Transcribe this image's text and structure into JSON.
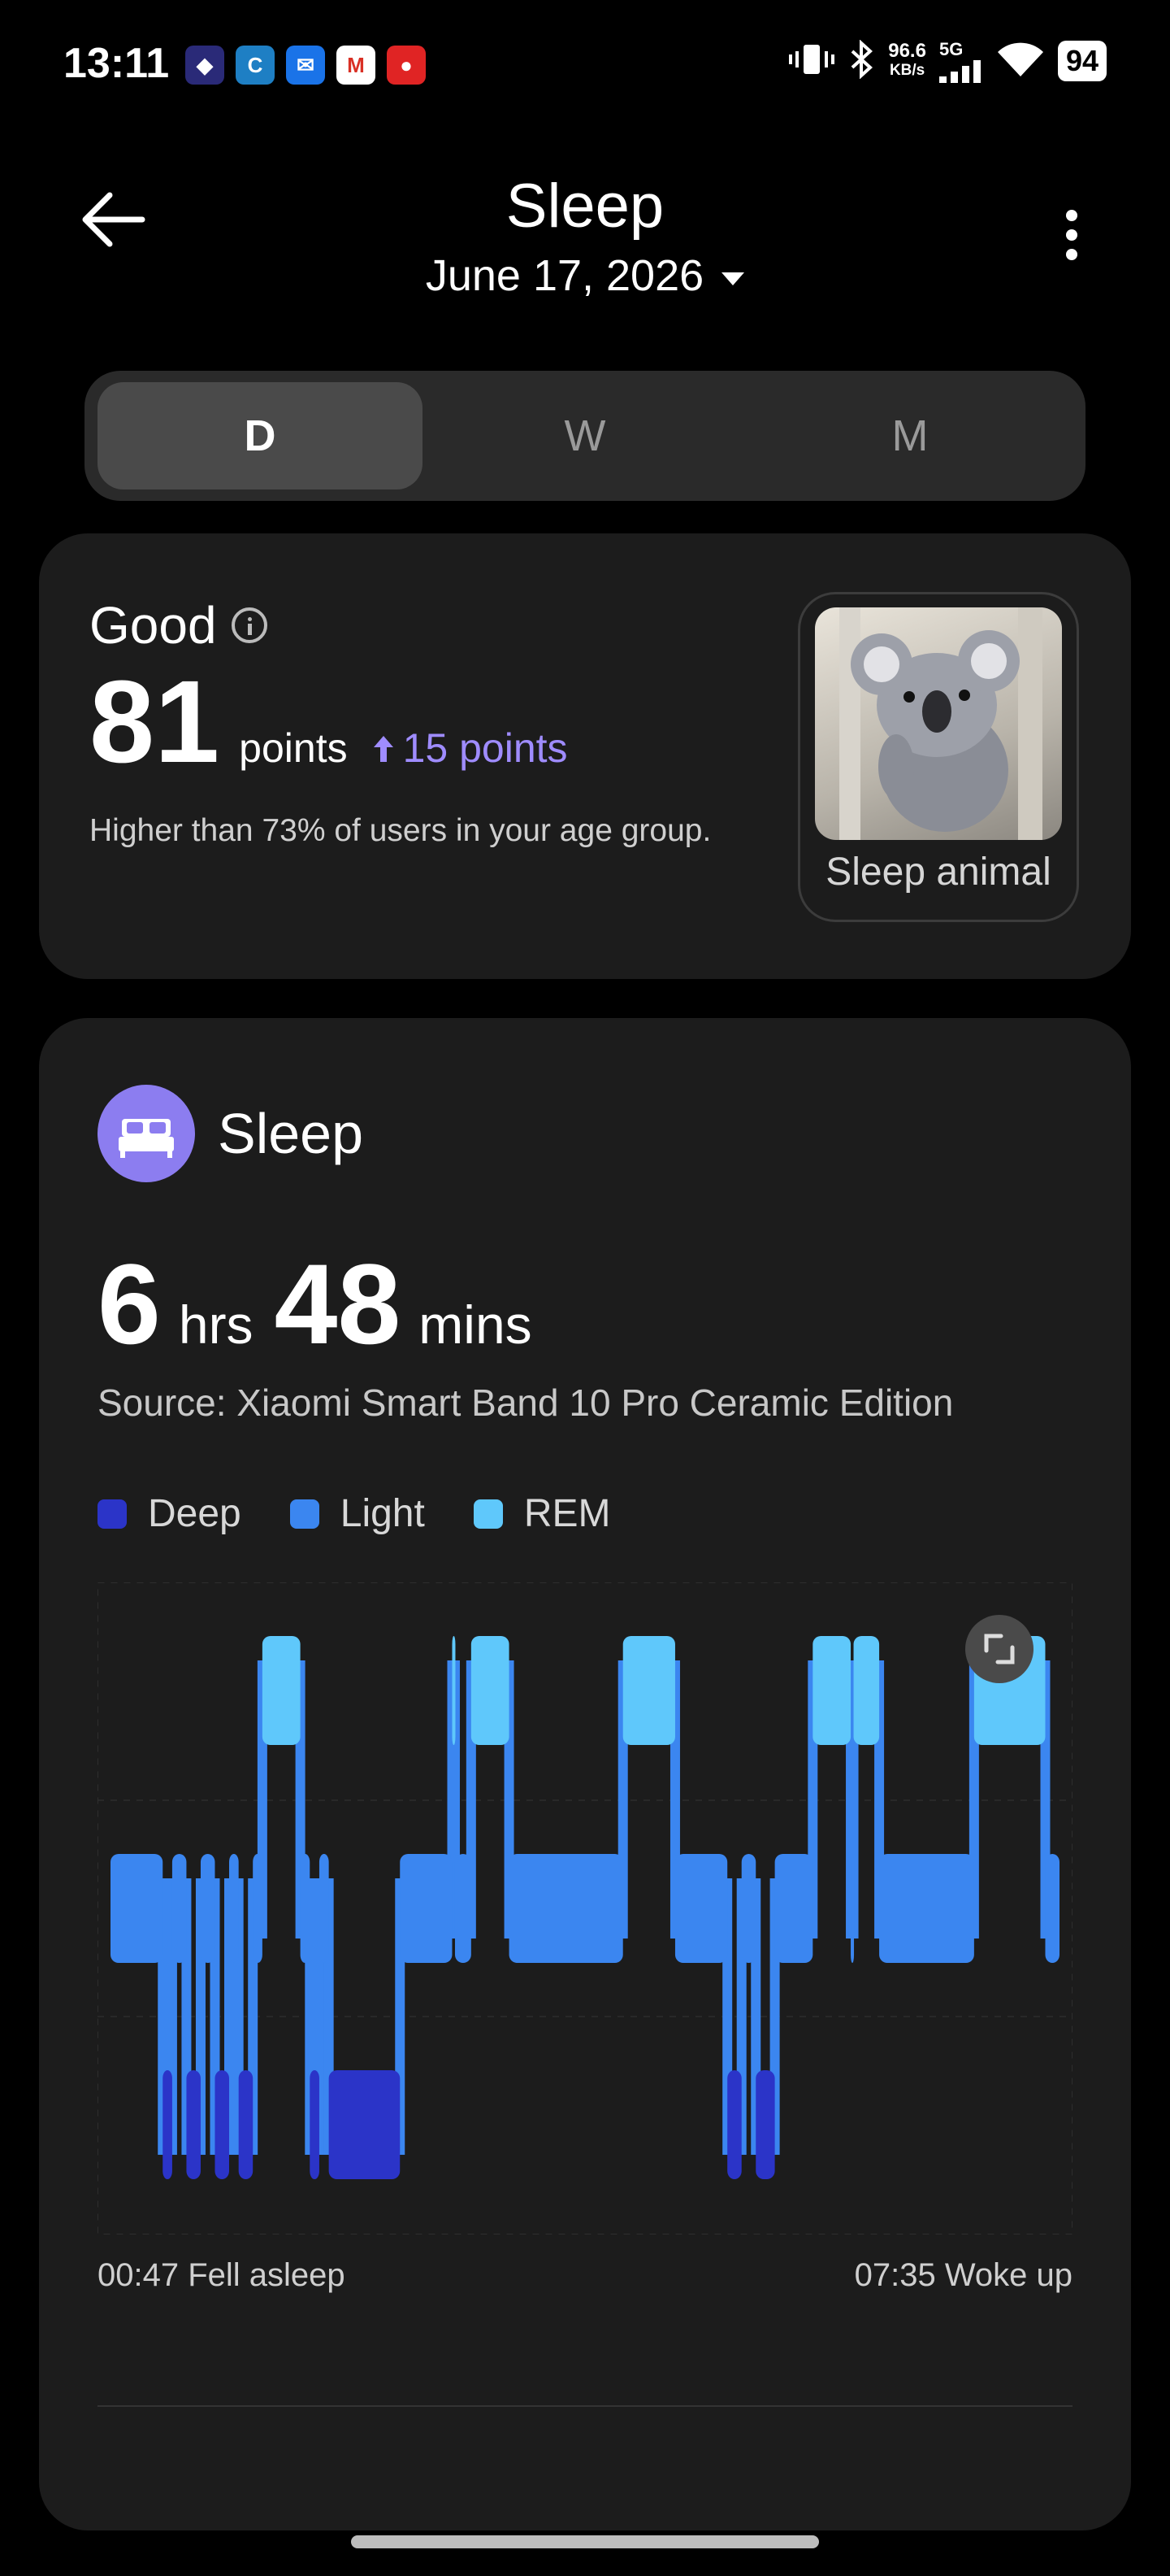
{
  "status_bar": {
    "time": "13:11",
    "speed_value": "96.6",
    "speed_unit": "KB/s",
    "network": "5G",
    "battery": "94"
  },
  "header": {
    "title": "Sleep",
    "date": "June 17, 2026"
  },
  "tabs": [
    {
      "label": "D",
      "active": true
    },
    {
      "label": "W",
      "active": false
    },
    {
      "label": "M",
      "active": false
    }
  ],
  "score_card": {
    "rating": "Good",
    "score": "81",
    "unit": "points",
    "delta": "15 points",
    "delta_direction": "up",
    "description": "Higher than 73% of users in your age group.",
    "animal_label": "Sleep animal",
    "delta_color": "#9f8cff"
  },
  "sleep_card": {
    "title": "Sleep",
    "hours": "6",
    "hours_unit": "hrs",
    "minutes": "48",
    "minutes_unit": "mins",
    "source": "Source: Xiaomi Smart Band 10 Pro Ceramic Edition",
    "legend": [
      {
        "label": "Deep",
        "color": "#2b34c8"
      },
      {
        "label": "Light",
        "color": "#3b86f0"
      },
      {
        "label": "REM",
        "color": "#5fc8fb"
      }
    ],
    "start_label": "00:47 Fell asleep",
    "end_label": "07:35 Woke up",
    "accent": "#8c7df0"
  },
  "chart_data": {
    "type": "hypnogram",
    "stages": [
      "REM",
      "Light",
      "Deep"
    ],
    "start": "00:47",
    "end": "07:35",
    "segments": [
      {
        "stage": "Light",
        "start": 0.0,
        "end": 0.055
      },
      {
        "stage": "Deep",
        "start": 0.055,
        "end": 0.065
      },
      {
        "stage": "Light",
        "start": 0.065,
        "end": 0.08
      },
      {
        "stage": "Deep",
        "start": 0.08,
        "end": 0.095
      },
      {
        "stage": "Light",
        "start": 0.095,
        "end": 0.11
      },
      {
        "stage": "Deep",
        "start": 0.11,
        "end": 0.125
      },
      {
        "stage": "Light",
        "start": 0.125,
        "end": 0.135
      },
      {
        "stage": "Deep",
        "start": 0.135,
        "end": 0.15
      },
      {
        "stage": "Light",
        "start": 0.15,
        "end": 0.16
      },
      {
        "stage": "REM",
        "start": 0.16,
        "end": 0.2
      },
      {
        "stage": "Light",
        "start": 0.2,
        "end": 0.21
      },
      {
        "stage": "Deep",
        "start": 0.21,
        "end": 0.22
      },
      {
        "stage": "Light",
        "start": 0.22,
        "end": 0.23
      },
      {
        "stage": "Deep",
        "start": 0.23,
        "end": 0.305
      },
      {
        "stage": "Light",
        "start": 0.305,
        "end": 0.36
      },
      {
        "stage": "REM",
        "start": 0.36,
        "end": 0.363
      },
      {
        "stage": "Light",
        "start": 0.363,
        "end": 0.38
      },
      {
        "stage": "REM",
        "start": 0.38,
        "end": 0.42
      },
      {
        "stage": "Light",
        "start": 0.42,
        "end": 0.54
      },
      {
        "stage": "REM",
        "start": 0.54,
        "end": 0.595
      },
      {
        "stage": "Light",
        "start": 0.595,
        "end": 0.65
      },
      {
        "stage": "Deep",
        "start": 0.65,
        "end": 0.665
      },
      {
        "stage": "Light",
        "start": 0.665,
        "end": 0.68
      },
      {
        "stage": "Deep",
        "start": 0.68,
        "end": 0.7
      },
      {
        "stage": "Light",
        "start": 0.7,
        "end": 0.74
      },
      {
        "stage": "REM",
        "start": 0.74,
        "end": 0.78
      },
      {
        "stage": "Light",
        "start": 0.78,
        "end": 0.783
      },
      {
        "stage": "REM",
        "start": 0.783,
        "end": 0.81
      },
      {
        "stage": "Light",
        "start": 0.81,
        "end": 0.91
      },
      {
        "stage": "REM",
        "start": 0.91,
        "end": 0.985
      },
      {
        "stage": "Light",
        "start": 0.985,
        "end": 1.0
      }
    ]
  }
}
